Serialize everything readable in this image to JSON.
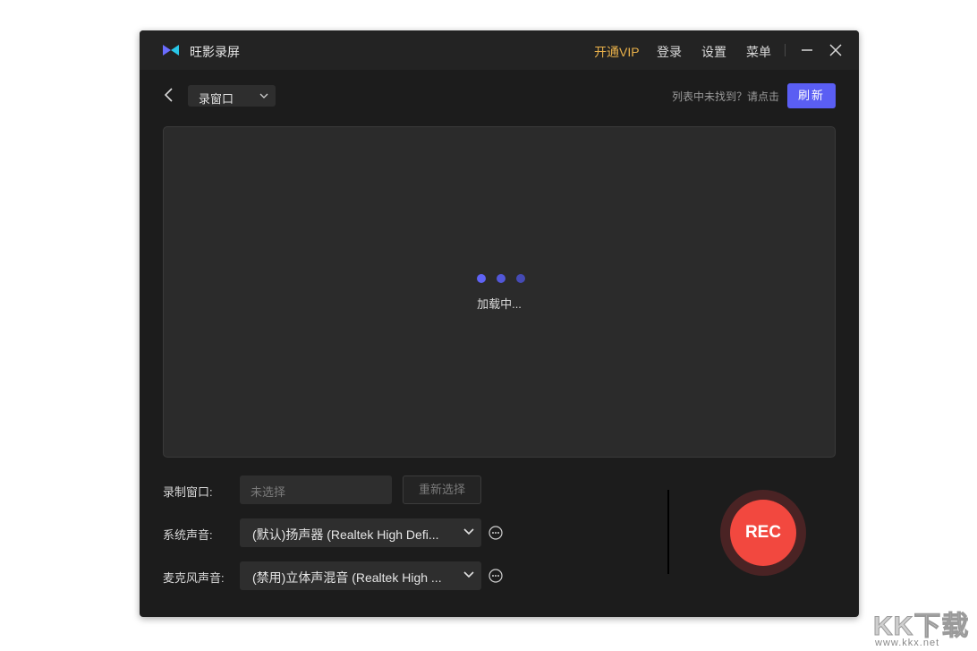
{
  "titlebar": {
    "app_name": "旺影录屏",
    "vip": "开通VIP",
    "login": "登录",
    "settings": "设置",
    "menu": "菜单"
  },
  "toolbar": {
    "mode": "录窗口",
    "hint": "列表中未找到？请点击",
    "refresh": "刷新"
  },
  "preview": {
    "loading": "加载中..."
  },
  "record_window": {
    "label": "录制窗口:",
    "placeholder": "未选择",
    "reselect": "重新选择"
  },
  "system_audio": {
    "label": "系统声音:",
    "value": "(默认)扬声器 (Realtek High Defi..."
  },
  "mic_audio": {
    "label": "麦克风声音:",
    "value": "(禁用)立体声混音 (Realtek High ..."
  },
  "rec_button": "REC",
  "watermark": {
    "brand": "KK下载",
    "url": "www.kkx.net"
  },
  "colors": {
    "accent": "#5a5ef3",
    "vip": "#e8b04a",
    "rec": "#f2483f"
  }
}
